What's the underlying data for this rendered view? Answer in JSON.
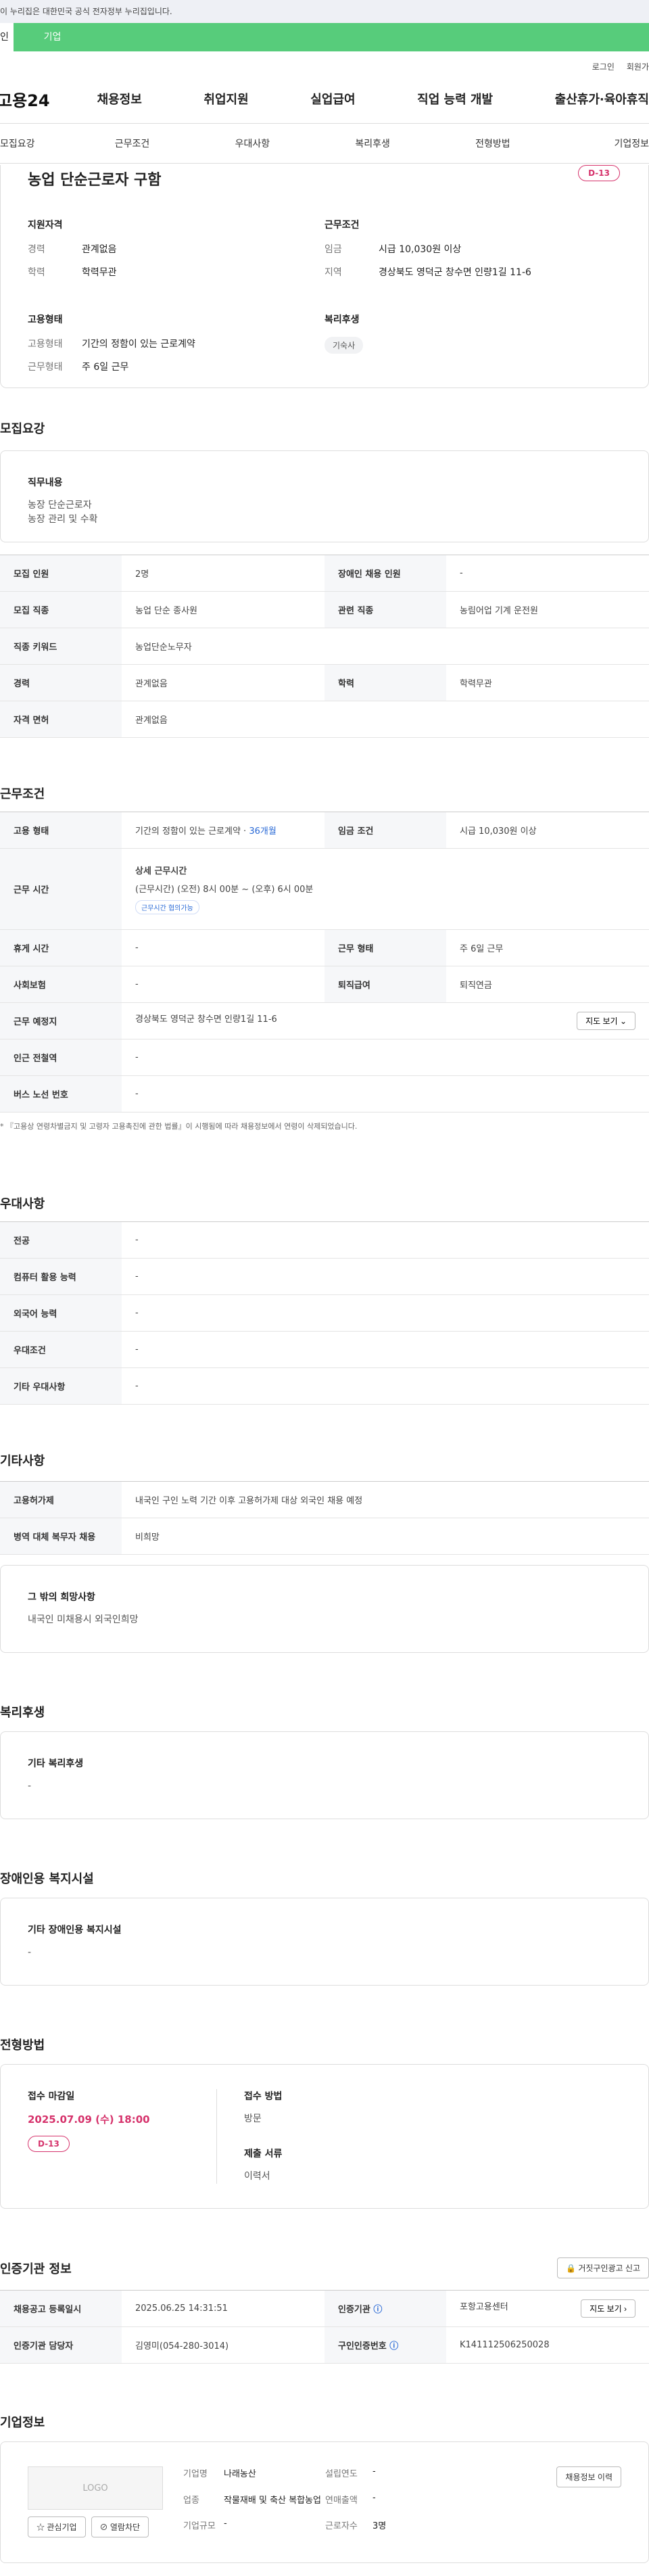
{
  "banner": "이 누리집은 대한민국 공식 전자정부 누리집입니다.",
  "top_tabs": [
    "인",
    "기업"
  ],
  "util": [
    "로그인",
    "회원가"
  ],
  "logo": "고용24",
  "gnb": [
    "채용정보",
    "취업지원",
    "실업급여",
    "직업 능력 개발",
    "출산휴가·육아휴직"
  ],
  "anchor": [
    "모집요강",
    "근무조건",
    "우대사항",
    "복리후생",
    "전형방법",
    "기업정보"
  ],
  "job": {
    "title": "농업 단순근로자 구함",
    "dday": "D-13",
    "qual_title": "지원자격",
    "qual": [
      {
        "k": "경력",
        "v": "관계없음"
      },
      {
        "k": "학력",
        "v": "학력무관"
      }
    ],
    "cond_title": "근무조건",
    "cond": [
      {
        "k": "임금",
        "v": "시급 10,030원 이상"
      },
      {
        "k": "지역",
        "v": "경상북도 영덕군 창수면 인량1길 11-6"
      }
    ],
    "type_title": "고용형태",
    "type": [
      {
        "k": "고용형태",
        "v": "기간의 정함이 있는 근로계약"
      },
      {
        "k": "근무형태",
        "v": "주 6일 근무"
      }
    ],
    "welfare_title": "복리후생",
    "welfare_chip": "기숙사"
  },
  "recruit": {
    "title": "모집요강",
    "duty_title": "직무내용",
    "duty": [
      "농장 단순근로자",
      "농장 관리 및 수확"
    ],
    "rows": [
      [
        "모집 인원",
        "2명",
        "장애인 채용 인원",
        "-"
      ],
      [
        "모집 직종",
        "농업 단순 종사원",
        "관련 직종",
        "농림어업 기계 운전원"
      ],
      [
        "직종 키워드",
        "농업단순노무자",
        "",
        ""
      ],
      [
        "경력",
        "관계없음",
        "학력",
        "학력무관"
      ],
      [
        "자격 면허",
        "관계없음",
        "",
        ""
      ]
    ]
  },
  "work": {
    "title": "근무조건",
    "type_label": "고용 형태",
    "type_value": "기간의 정함이 있는 근로계약 · ",
    "type_months": "36개월",
    "wage_label": "임금 조건",
    "wage_value": "시급 10,030원 이상",
    "time_label": "근무 시간",
    "time_title": "상세 근무시간",
    "time_value": "(근무시간) (오전) 8시 00분 ~ (오후) 6시 00분",
    "time_chip": "근무시간 협의가능",
    "rest_label": "휴게 시간",
    "rest_value": "-",
    "shape_label": "근무 형태",
    "shape_value": "주 6일 근무",
    "ins_label": "사회보험",
    "ins_value": "-",
    "sev_label": "퇴직급여",
    "sev_value": "퇴직연금",
    "place_label": "근무 예정지",
    "place_value": "경상북도 영덕군 창수면 인량1길 11-6",
    "map_btn": "지도 보기",
    "subway_label": "인근 전철역",
    "subway_value": "-",
    "bus_label": "버스 노선 번호",
    "bus_value": "-",
    "note": "* 『고용상 연령차별금지 및 고령자 고용촉진에 관한 법률』이 시행됨에 따라 채용정보에서 연령이 삭제되었습니다."
  },
  "pref": {
    "title": "우대사항",
    "rows": [
      [
        "전공",
        "-"
      ],
      [
        "컴퓨터 활용 능력",
        "-"
      ],
      [
        "외국어 능력",
        "-"
      ],
      [
        "우대조건",
        "-"
      ],
      [
        "기타 우대사항",
        "-"
      ]
    ]
  },
  "etc": {
    "title": "기타사항",
    "rows": [
      [
        "고용허가제",
        "내국인 구인 노력 기간 이후 고용허가제 대상 외국인 채용 예정"
      ],
      [
        "병역 대체 복무자 채용",
        "비희망"
      ]
    ],
    "hope_title": "그 밖의 희망사항",
    "hope_value": "내국인 미채용시 외국인희망"
  },
  "benefit": {
    "title": "복리후생",
    "box_title": "기타 복리후생",
    "box_value": "-"
  },
  "disabled": {
    "title": "장애인용 복지시설",
    "box_title": "기타 장애인용 복지시설",
    "box_value": "-"
  },
  "process": {
    "title": "전형방법",
    "deadline_label": "접수 마감일",
    "deadline": "2025.07.09 (수) 18:00",
    "dday": "D-13",
    "method_label": "접수 방법",
    "method": "방문",
    "docs_label": "제출 서류",
    "docs": "이력서"
  },
  "cert": {
    "title": "인증기관 정보",
    "report_btn": "거짓구인광고 신고",
    "rows": [
      [
        "채용공고 등록일시",
        "2025.06.25 14:31:51",
        "인증기관",
        "포항고용센터"
      ],
      [
        "인증기관 담당자",
        "김영미(054-280-3014)",
        "구인인증번호",
        "K141112506250028"
      ]
    ],
    "map_btn": "지도 보기"
  },
  "company": {
    "title": "기업정보",
    "logo_text": "LOGO",
    "fav_btn": "관심기업",
    "block_btn": "열람차단",
    "name_label": "기업명",
    "name": "나래농산",
    "industry_label": "업종",
    "industry": "작물재배 및 축산 복합농업",
    "size_label": "기업규모",
    "size": "-",
    "founded_label": "설립연도",
    "founded": "-",
    "revenue_label": "연매출액",
    "revenue": "-",
    "employees_label": "근로자수",
    "employees": "3명",
    "history_btn": "채용정보 이력"
  }
}
